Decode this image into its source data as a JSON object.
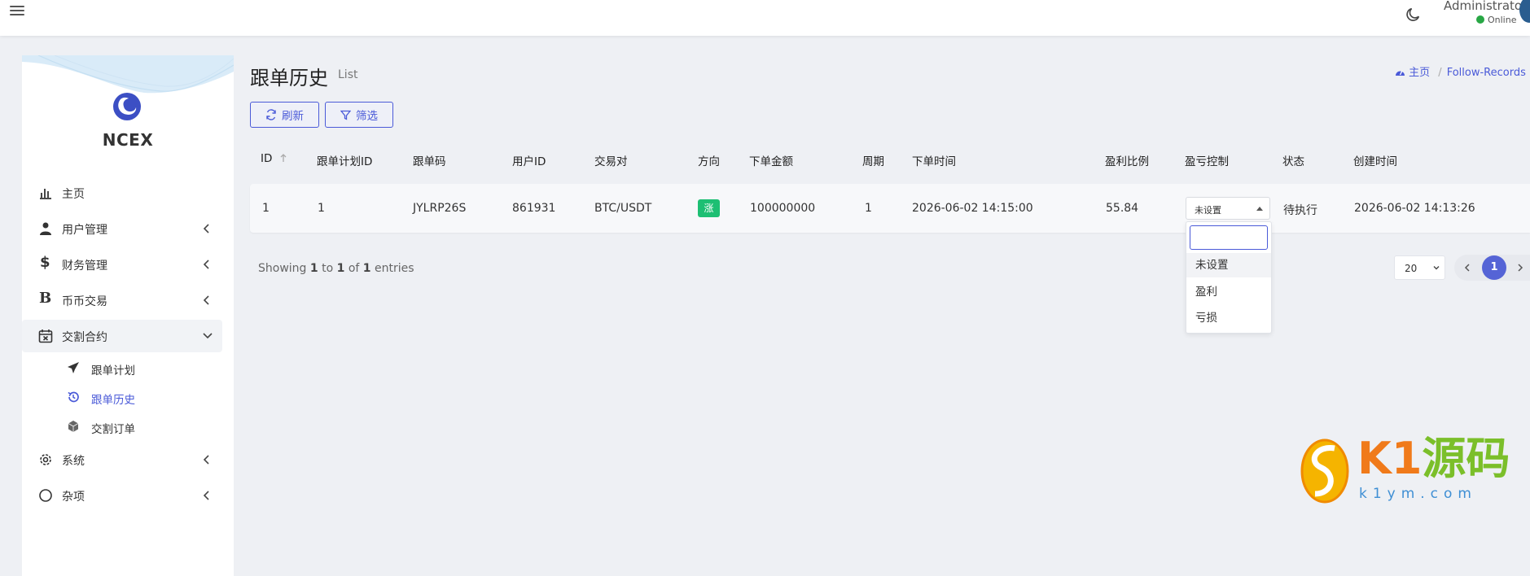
{
  "header": {
    "user_name": "Administrator",
    "status": "Online"
  },
  "brand": {
    "name": "NCEX"
  },
  "sidebar": {
    "items": [
      {
        "label": "主页"
      },
      {
        "label": "用户管理"
      },
      {
        "label": "财务管理"
      },
      {
        "label": "币币交易"
      },
      {
        "label": "交割合约"
      },
      {
        "label": "系统"
      },
      {
        "label": "杂项"
      }
    ],
    "sub_items": [
      {
        "label": "跟单计划"
      },
      {
        "label": "跟单历史"
      },
      {
        "label": "交割订单"
      }
    ],
    "active_sub": "跟单历史"
  },
  "page": {
    "title": "跟单历史",
    "subtitle": "List"
  },
  "breadcrumb": {
    "home": "主页",
    "current": "Follow-Records"
  },
  "toolbar": {
    "refresh_label": "刷新",
    "filter_label": "筛选"
  },
  "table": {
    "columns": [
      "ID",
      "跟单计划ID",
      "跟单码",
      "用户ID",
      "交易对",
      "方向",
      "下单金额",
      "周期",
      "下单时间",
      "盈利比例",
      "盈亏控制",
      "状态",
      "创建时间"
    ],
    "rows": [
      {
        "id": "1",
        "plan_id": "1",
        "code": "JYLRP26S",
        "user_id": "861931",
        "pair": "BTC/USDT",
        "direction": "涨",
        "amount": "100000000",
        "period": "1",
        "order_time": "2026-06-02 14:15:00",
        "profit_ratio": "55.84",
        "control": "未设置",
        "status": "待执行",
        "created": "2026-06-02 14:13:26"
      }
    ]
  },
  "control_dropdown": {
    "options": [
      "未设置",
      "盈利",
      "亏损"
    ],
    "highlighted": "未设置"
  },
  "pagination": {
    "prefix": "Showing",
    "from": "1",
    "to_word": "to",
    "to": "1",
    "of_word": "of",
    "total": "1",
    "suffix": "entries",
    "page_size": "20",
    "current_page": "1"
  },
  "watermark": {
    "text_prefix": "K1",
    "text_cn": "源码",
    "url": "k1ym.com"
  },
  "colors": {
    "accent": "#4a5ad8",
    "rise_badge": "#1dbf73",
    "online": "#28a745",
    "background": "#eef0f4"
  }
}
